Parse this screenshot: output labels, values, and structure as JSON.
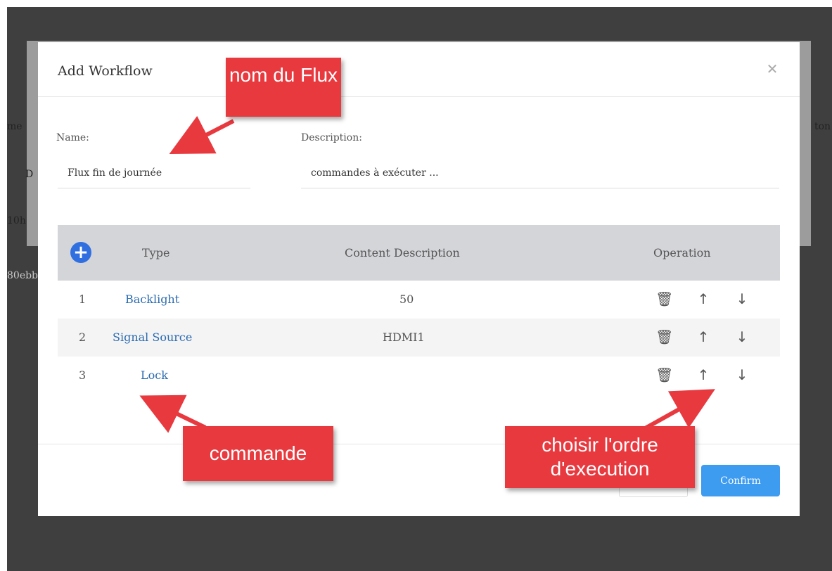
{
  "background_page": {
    "fragments": [
      "me",
      "D",
      "10h",
      "80ebb",
      "ton"
    ]
  },
  "modal": {
    "title": "Add Workflow",
    "name_label": "Name:",
    "name_value": "Flux fin de journée",
    "description_label": "Description:",
    "description_value": "commandes à exécuter ..."
  },
  "table": {
    "headers": {
      "type": "Type",
      "content": "Content Description",
      "operation": "Operation"
    },
    "rows": [
      {
        "index": "1",
        "type": "Backlight",
        "content": "50"
      },
      {
        "index": "2",
        "type": "Signal Source",
        "content": "HDMI1"
      },
      {
        "index": "3",
        "type": "Lock",
        "content": ""
      }
    ]
  },
  "footer": {
    "cancel_label": "",
    "confirm_label": "Confirm"
  },
  "annotations": {
    "name_callout": "nom du Flux",
    "command_callout": "commande",
    "order_callout": "choisir l'ordre d'execution"
  },
  "icons": {
    "close": "close-icon",
    "add": "add-circle-icon",
    "delete": "trash-icon",
    "up": "arrow-up-icon",
    "down": "arrow-down-icon"
  },
  "colors": {
    "overlay": "#3f3f3f",
    "header_bg": "#d4d5d9",
    "link": "#2a6bb0",
    "confirm": "#3d9bf0",
    "add_button": "#2f6fe0",
    "callout": "#e8393f"
  }
}
